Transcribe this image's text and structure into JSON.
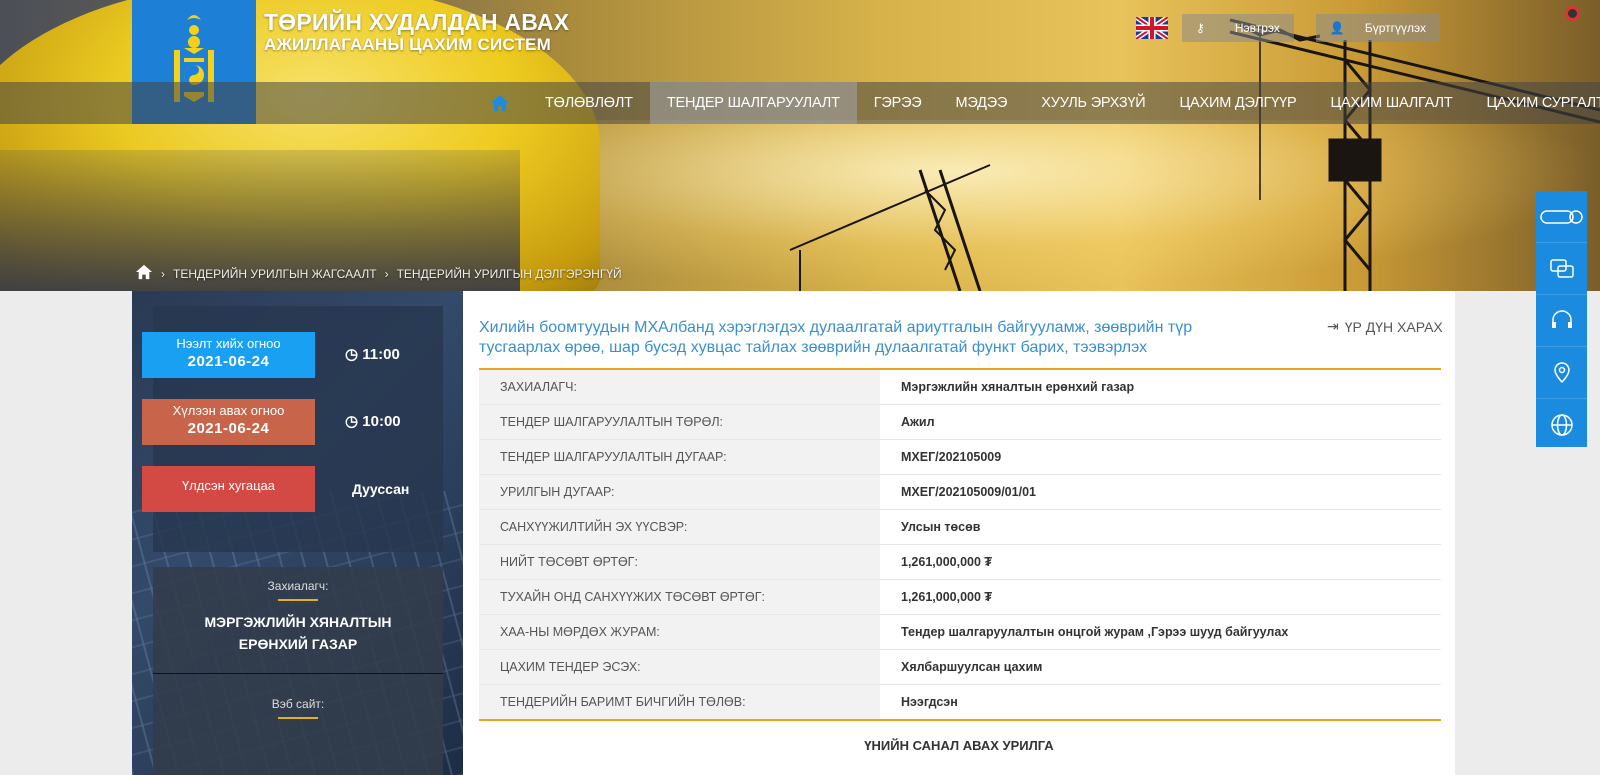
{
  "header": {
    "title_line1": "ТӨРИЙН ХУДАЛДАН АВАХ",
    "title_line2": "АЖИЛЛАГААНЫ ЦАХИМ СИСТЕМ",
    "login_label": "Нэвтрэх",
    "register_label": "Бүртгүүлэх"
  },
  "nav": {
    "items": [
      "ТӨЛӨВЛӨЛТ",
      "ТЕНДЕР ШАЛГАРУУЛАЛТ",
      "ГЭРЭЭ",
      "МЭДЭЭ",
      "ХУУЛЬ ЭРХЗҮЙ",
      "ЦАХИМ ДЭЛГҮҮР",
      "ЦАХИМ ШАЛГАЛТ",
      "ЦАХИМ СУРГАЛТ"
    ],
    "active_index": 1
  },
  "breadcrumb": {
    "item1": "ТЕНДЕРИЙН УРИЛГЫН ЖАГСААЛТ",
    "item2": "ТЕНДЕРИЙН УРИЛГЫН ДЭЛГЭРЭНГҮЙ"
  },
  "timer": {
    "open_label": "Нээлт хийх огноо",
    "open_date": "2021-06-24",
    "open_time": "11:00",
    "receive_label": "Хүлээн авах огноо",
    "receive_date": "2021-06-24",
    "receive_time": "10:00",
    "remaining_label": "Үлдсэн хугацаа",
    "remaining_value": "Дууссан"
  },
  "client": {
    "label": "Захиалагч:",
    "name": "МЭРГЭЖЛИЙН ХЯНАЛТЫН ЕРӨНХИЙ ГАЗАР",
    "website_label": "Вэб сайт:"
  },
  "tender": {
    "title": "Хилийн боомтуудын МХАлбанд хэрэглэгдэх дулаалгатай ариутгалын байгууламж, зөөврийн түр тусгаарлах өрөө, шар бусэд хувцас тайлах зөөврийн дулаалгатай функт барих, тээвэрлэх",
    "result_label": "ҮР ДҮН ХАРАХ",
    "rows": [
      {
        "k": "ЗАХИАЛАГЧ:",
        "v": "Мэргэжлийн хяналтын ерөнхий газар"
      },
      {
        "k": "ТЕНДЕР ШАЛГАРУУЛАЛТЫН ТӨРӨЛ:",
        "v": "Ажил"
      },
      {
        "k": "ТЕНДЕР ШАЛГАРУУЛАЛТЫН ДУГААР:",
        "v": "МХЕГ/202105009"
      },
      {
        "k": "УРИЛГЫН ДУГААР:",
        "v": "МХЕГ/202105009/01/01"
      },
      {
        "k": "САНХҮҮЖИЛТИЙН ЭХ ҮҮСВЭР:",
        "v": "Улсын төсөв"
      },
      {
        "k": "НИЙТ ТӨСӨВТ ӨРТӨГ:",
        "v": "1,261,000,000 ₮"
      },
      {
        "k": "ТУХАЙН ОНД САНХҮҮЖИХ ТӨСӨВТ ӨРТӨГ:",
        "v": "1,261,000,000 ₮"
      },
      {
        "k": "ХАА-НЫ МӨРДӨХ ЖУРАМ:",
        "v": "Тендер шалгаруулалтын онцгой журам ,Гэрээ шууд байгуулах"
      },
      {
        "k": "ЦАХИМ ТЕНДЕР ЭСЭХ:",
        "v": "Хялбаршуулсан цахим"
      },
      {
        "k": "ТЕНДЕРИЙН БАРИМТ БИЧГИЙН ТӨЛӨВ:",
        "v": "Нээгдсэн"
      }
    ],
    "section_title": "ҮНИЙН САНАЛ АВАХ УРИЛГА"
  },
  "colors": {
    "accent_blue": "#1b8be0",
    "open_label_bg": "#1aa0f2",
    "receive_label_bg": "#c8644a",
    "remaining_label_bg": "#d24a43",
    "divider_gold": "#e8a51a"
  }
}
